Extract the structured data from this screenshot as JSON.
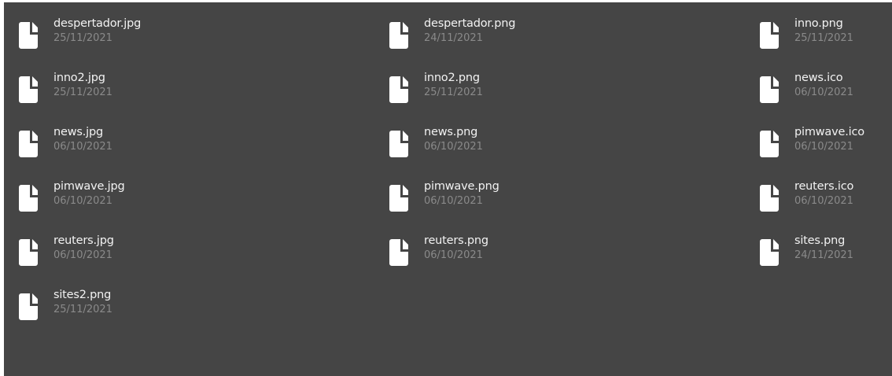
{
  "files": [
    {
      "name": "despertador.jpg",
      "date": "25/11/2021",
      "icon": "file-icon"
    },
    {
      "name": "despertador.png",
      "date": "24/11/2021",
      "icon": "file-icon"
    },
    {
      "name": "inno.png",
      "date": "25/11/2021",
      "icon": "file-icon"
    },
    {
      "name": "inno2.jpg",
      "date": "25/11/2021",
      "icon": "file-icon"
    },
    {
      "name": "inno2.png",
      "date": "25/11/2021",
      "icon": "file-icon"
    },
    {
      "name": "news.ico",
      "date": "06/10/2021",
      "icon": "file-icon"
    },
    {
      "name": "news.jpg",
      "date": "06/10/2021",
      "icon": "file-icon"
    },
    {
      "name": "news.png",
      "date": "06/10/2021",
      "icon": "file-icon"
    },
    {
      "name": "pimwave.ico",
      "date": "06/10/2021",
      "icon": "file-icon"
    },
    {
      "name": "pimwave.jpg",
      "date": "06/10/2021",
      "icon": "file-icon"
    },
    {
      "name": "pimwave.png",
      "date": "06/10/2021",
      "icon": "file-icon"
    },
    {
      "name": "reuters.ico",
      "date": "06/10/2021",
      "icon": "file-icon"
    },
    {
      "name": "reuters.jpg",
      "date": "06/10/2021",
      "icon": "file-icon"
    },
    {
      "name": "reuters.png",
      "date": "06/10/2021",
      "icon": "file-icon"
    },
    {
      "name": "sites.png",
      "date": "24/11/2021",
      "icon": "file-icon"
    },
    {
      "name": "sites2.png",
      "date": "25/11/2021",
      "icon": "file-icon"
    }
  ],
  "colors": {
    "background": "#454545",
    "name_text": "#f2f2f2",
    "date_text": "#8a8a8a",
    "icon": "#ffffff"
  }
}
